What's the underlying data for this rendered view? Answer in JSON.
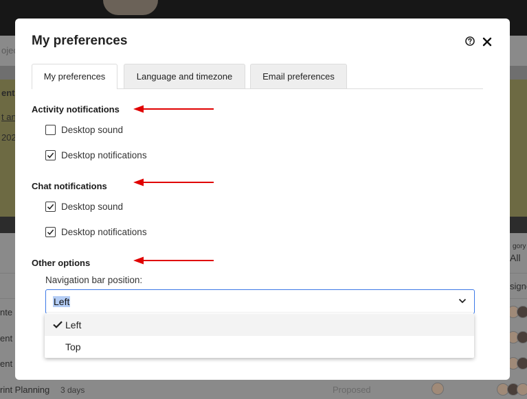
{
  "background": {
    "search_fragment": "ojec",
    "left_fragment_1": "ent",
    "left_fragment_2": "t an",
    "left_fragment_3": "202",
    "category_label": "gory",
    "category_value": "All",
    "assign_label": "signe",
    "rows": [
      {
        "text": "nte"
      },
      {
        "text": "ent"
      },
      {
        "text": "ent"
      },
      {
        "text": "rint Planning",
        "duration": "3 days",
        "status": "Proposed"
      }
    ]
  },
  "modal": {
    "title": "My preferences",
    "icons": {
      "help": "help-circle-icon",
      "close": "close-icon"
    },
    "tabs": [
      {
        "label": "My preferences",
        "active": true
      },
      {
        "label": "Language and timezone",
        "active": false
      },
      {
        "label": "Email preferences",
        "active": false
      }
    ],
    "sections": {
      "activity": {
        "title": "Activity notifications",
        "options": [
          {
            "label": "Desktop sound",
            "checked": false
          },
          {
            "label": "Desktop notifications",
            "checked": true
          }
        ]
      },
      "chat": {
        "title": "Chat notifications",
        "options": [
          {
            "label": "Desktop sound",
            "checked": true
          },
          {
            "label": "Desktop notifications",
            "checked": true
          }
        ]
      },
      "other": {
        "title": "Other options",
        "nav_label": "Navigation bar position:",
        "nav_value": "Left",
        "nav_options": [
          {
            "label": "Left",
            "selected": true
          },
          {
            "label": "Top",
            "selected": false
          }
        ]
      }
    }
  },
  "colors": {
    "accent": "#3b78e7",
    "annotation_arrow": "#e00000"
  }
}
